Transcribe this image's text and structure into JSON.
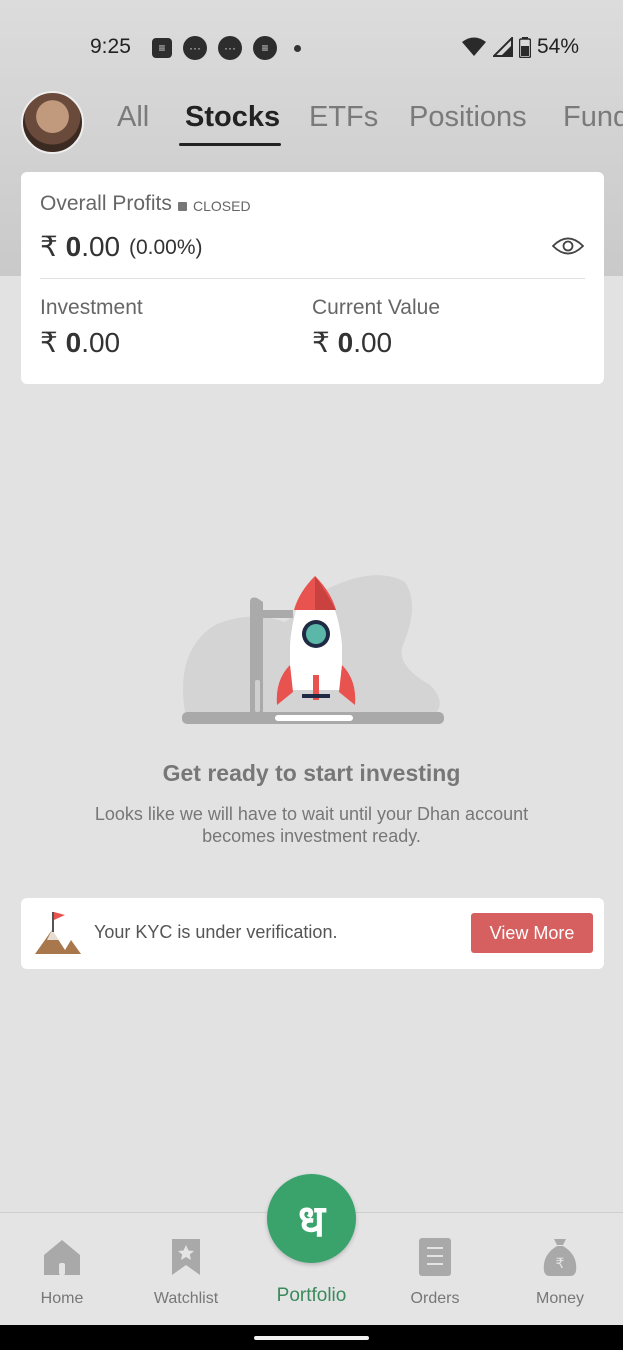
{
  "status_bar": {
    "time": "9:25",
    "battery": "54%",
    "icons": [
      "message-icon",
      "chat-icon",
      "chat-icon",
      "app-icon",
      "dot-icon",
      "wifi-icon",
      "signal-icon",
      "battery-icon"
    ]
  },
  "tabs": [
    {
      "label": "All",
      "active": false
    },
    {
      "label": "Stocks",
      "active": true
    },
    {
      "label": "ETFs",
      "active": false
    },
    {
      "label": "Positions",
      "active": false
    },
    {
      "label": "Fund",
      "active": false
    }
  ],
  "profit_card": {
    "title": "Overall Profits",
    "status": "CLOSED",
    "profit_currency": "₹",
    "profit_int": "0",
    "profit_dec": ".00",
    "profit_pct": "(0.00%)",
    "investment_label": "Investment",
    "investment_currency": "₹",
    "investment_int": "0",
    "investment_dec": ".00",
    "current_label": "Current Value",
    "current_currency": "₹",
    "current_int": "0",
    "current_dec": ".00"
  },
  "empty_state": {
    "title": "Get ready to start investing",
    "subtitle": "Looks like we will have to wait until your Dhan account becomes investment ready."
  },
  "kyc": {
    "text": "Your KYC is under verification.",
    "button": "View More"
  },
  "bottom_nav": {
    "home": "Home",
    "watchlist": "Watchlist",
    "portfolio": "Portfolio",
    "orders": "Orders",
    "money": "Money",
    "fab_glyph": "ध",
    "money_glyph": "₹"
  },
  "colors": {
    "accent_green": "#3aa36b",
    "button_red": "#d65f5f",
    "rocket_red": "#e8524f"
  }
}
